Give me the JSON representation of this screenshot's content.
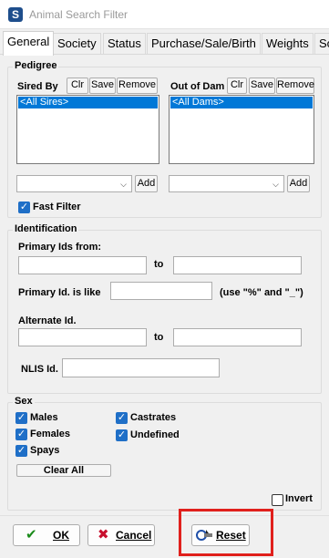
{
  "window": {
    "title": "Animal Search Filter",
    "app_icon_letter": "S"
  },
  "tabs": [
    "General",
    "Society",
    "Status",
    "Purchase/Sale/Birth",
    "Weights",
    "So"
  ],
  "pedigree": {
    "group_label": "Pedigree",
    "sires": {
      "label": "Sired By",
      "clr": "Clr",
      "save": "Save",
      "remove": "Remove",
      "selected": "<All Sires>",
      "add": "Add"
    },
    "dams": {
      "label": "Out of Dam",
      "clr": "Clr",
      "save": "Save",
      "remove": "Remove",
      "selected": "<All Dams>",
      "add": "Add"
    },
    "fast_filter": {
      "label": "Fast Filter",
      "checked": true
    }
  },
  "identification": {
    "group_label": "Identification",
    "primary_from_label": "Primary Ids from:",
    "to1": "to",
    "primary_like_label": "Primary Id. is like",
    "like_hint": "(use \"%\" and \"_\")",
    "alternate_label": "Alternate Id.",
    "to2": "to",
    "nlis_label": "NLIS Id."
  },
  "sex": {
    "group_label": "Sex",
    "males": "Males",
    "females": "Females",
    "spays": "Spays",
    "castrates": "Castrates",
    "undefined": "Undefined",
    "clear_all": "Clear All",
    "invert": "Invert"
  },
  "buttons": {
    "ok": "OK",
    "cancel": "Cancel",
    "reset": "Reset"
  },
  "colors": {
    "accent": "#0078d7",
    "highlight_box": "#e0201c",
    "ok_icon": "#1a8a1a",
    "cancel_icon": "#c8102e"
  }
}
